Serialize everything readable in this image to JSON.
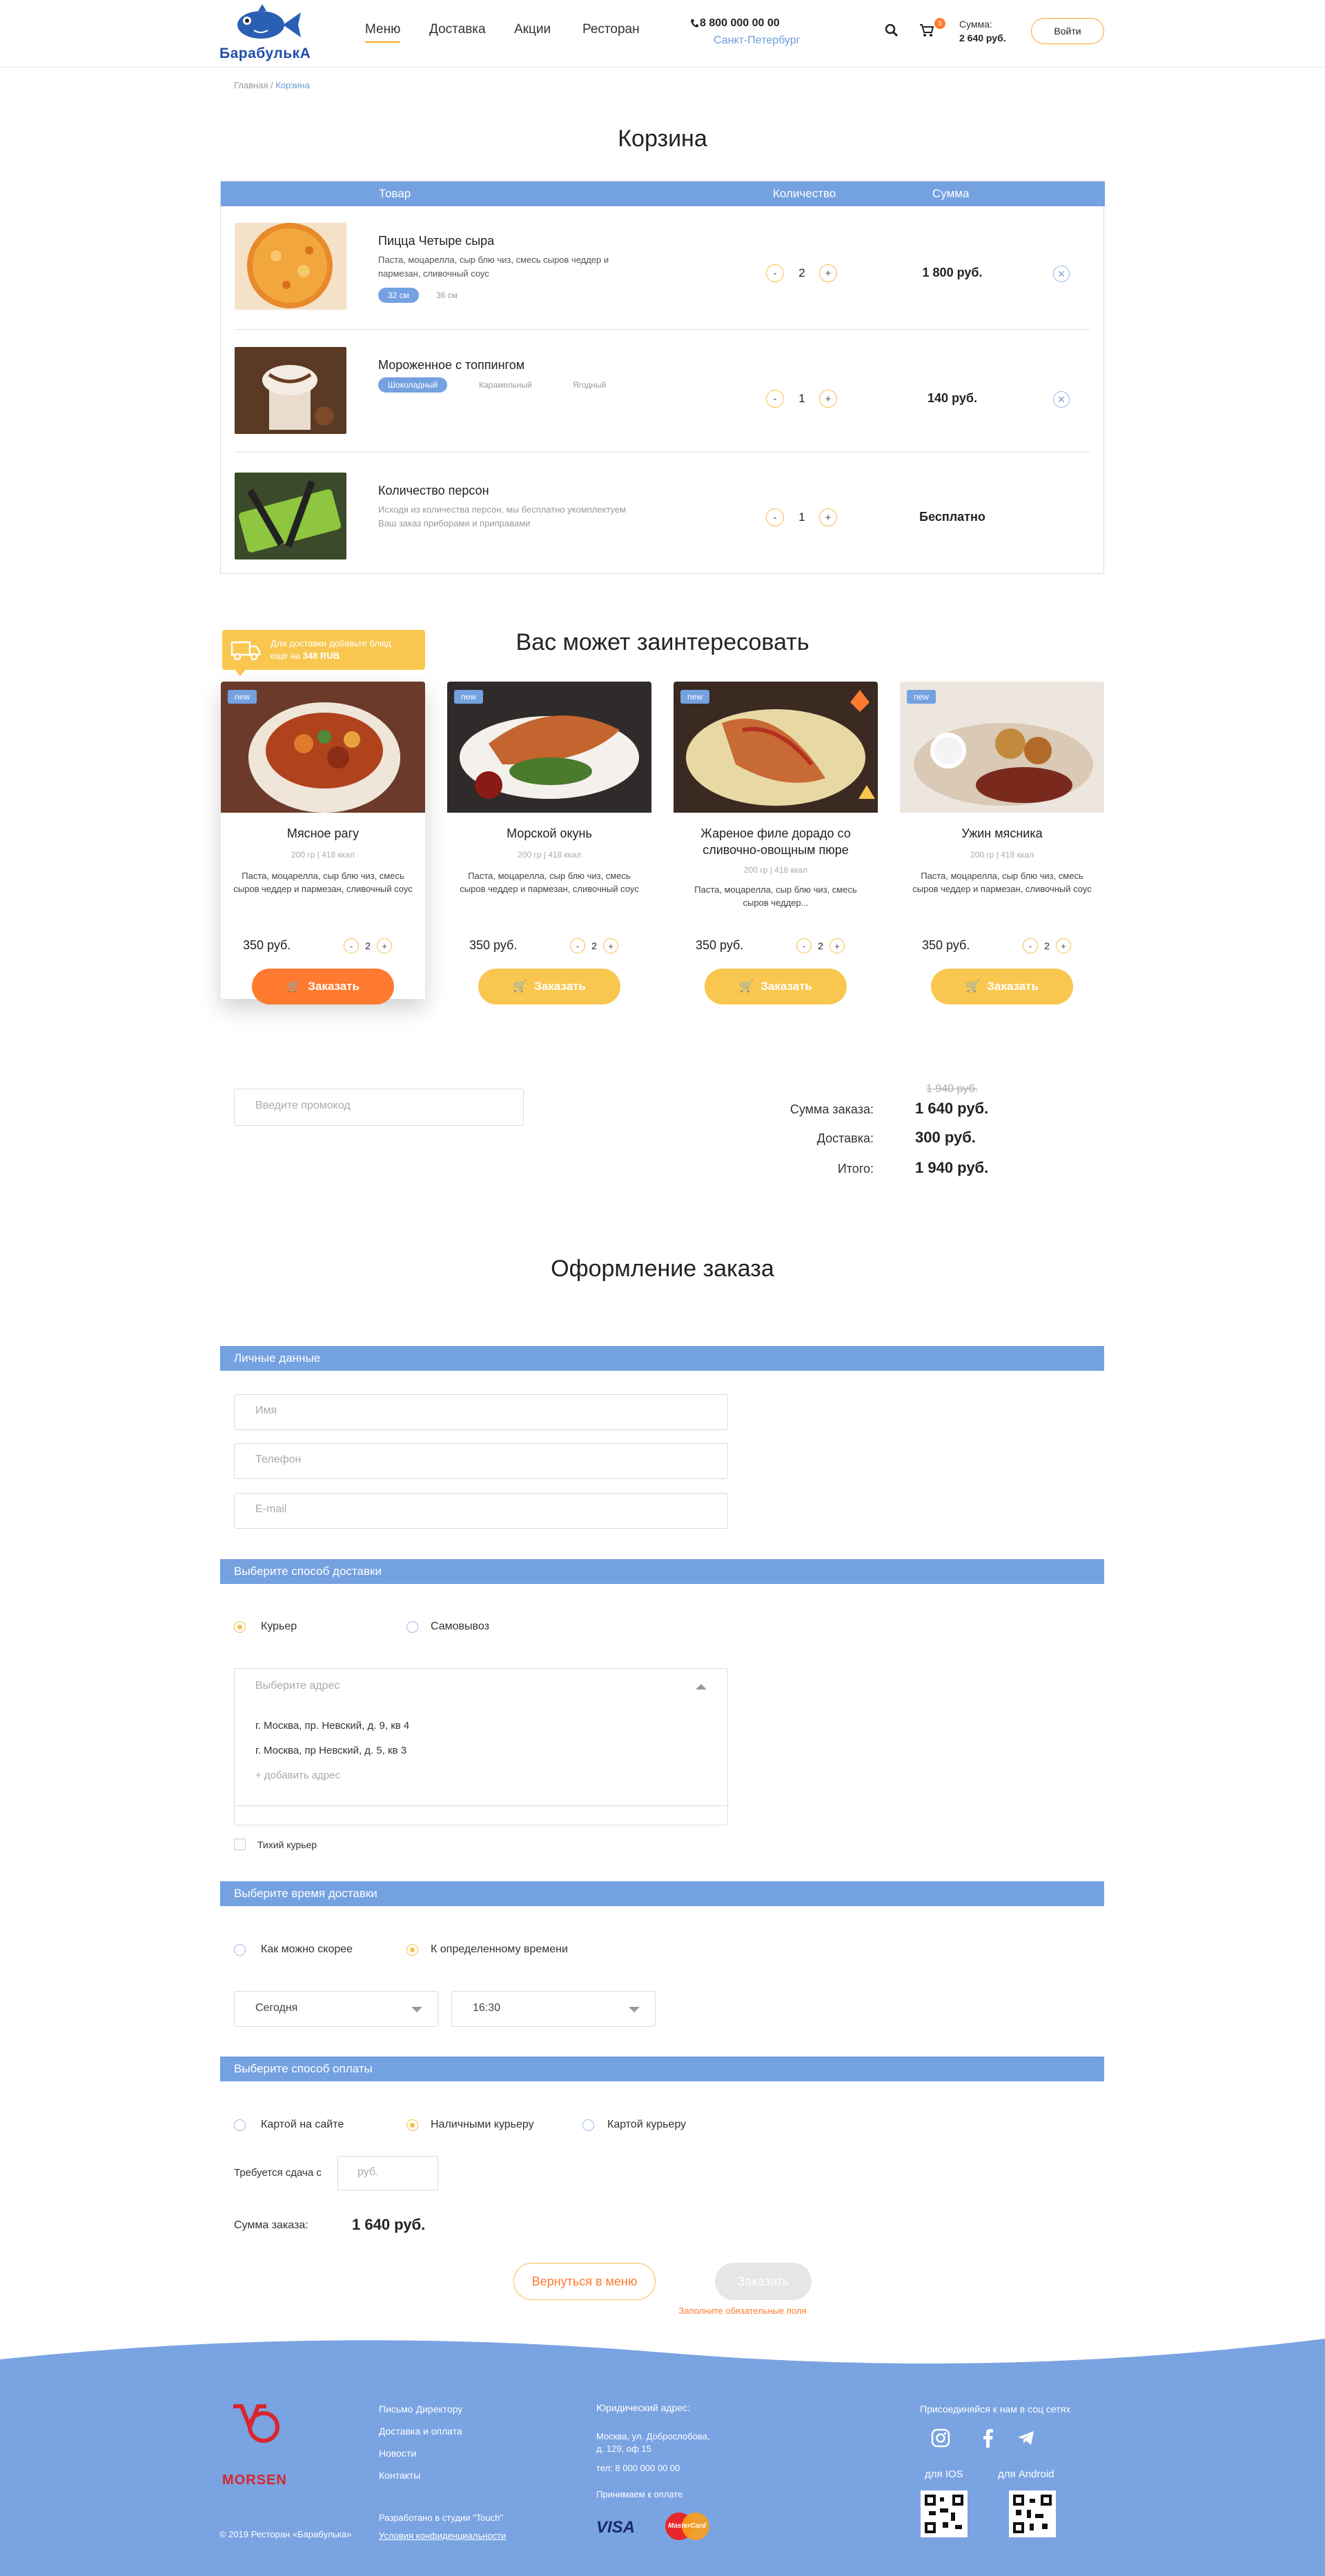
{
  "header": {
    "logo_text": "БарабулькА",
    "nav": [
      "Меню",
      "Доставка",
      "Акции",
      "Ресторан"
    ],
    "phone": "8 800 000 00 00",
    "city": "Санкт-Петербург",
    "cart_count": "5",
    "cart_sum_label": "Сумма:",
    "cart_sum": "2 640 руб.",
    "login": "Войти"
  },
  "breadcrumb": {
    "home": "Главная",
    "sep": " / ",
    "current": "Корзина"
  },
  "cart": {
    "title": "Корзина",
    "columns": {
      "product": "Товар",
      "qty": "Количество",
      "sum": "Сумма"
    },
    "items": [
      {
        "name": "Пицца Четыре сыра",
        "desc": "Паста, моцарелла, сыр блю чиз, смесь сыров чеддер и пармезан, сливочный соус",
        "options": [
          "32 см",
          "36 см"
        ],
        "qty": "2",
        "sum": "1 800 руб.",
        "removable": true
      },
      {
        "name": "Мороженное с топпингом",
        "desc": "",
        "options": [
          "Шоколадный",
          "Карамельный",
          "Ягодный"
        ],
        "qty": "1",
        "sum": "140 руб.",
        "removable": true
      },
      {
        "name": "Количество персон",
        "desc": "Исходя из количества персон, мы бесплатно укомплектуем Ваш заказ приборами и приправами",
        "options": [],
        "qty": "1",
        "sum": "Бесплатно",
        "removable": false
      }
    ],
    "minus": "-",
    "plus": "+"
  },
  "recommend": {
    "title": "Вас может заинтересовать",
    "delivery_banner_line1": "Для доставки добавьте блюд",
    "delivery_banner_line2_prefix": "еще на ",
    "delivery_banner_amount": "348 RUB",
    "badge_new": "new",
    "order_label": "Заказать",
    "items": [
      {
        "title": "Мясное рагу",
        "meta": "200 гр  |  418 ккал",
        "desc": "Паста, моцарелла, сыр блю чиз, смесь сыров чеддер и пармезан, сливочный соус",
        "price": "350 руб.",
        "qty": "2"
      },
      {
        "title": "Морской окунь",
        "meta": "200 гр  |  418 ккал",
        "desc": "Паста, моцарелла, сыр блю чиз, смесь сыров чеддер и пармезан, сливочный соус",
        "price": "350 руб.",
        "qty": "2"
      },
      {
        "title": "Жареное филе дорадо со сливочно-овощным пюре",
        "meta": "200 гр  |  418 ккал",
        "desc": "Паста, моцарелла, сыр блю чиз, смесь сыров чеддер...",
        "price": "350 руб.",
        "qty": "2"
      },
      {
        "title": "Ужин мясника",
        "meta": "200 гр  |  418 ккал",
        "desc": "Паста, моцарелла, сыр блю чиз, смесь сыров чеддер и пармезан, сливочный соус",
        "price": "350 руб.",
        "qty": "2"
      }
    ],
    "colors": {
      "highlight_button": "#ff7a2f",
      "button": "#f9c74f"
    }
  },
  "totals": {
    "promo_placeholder": "Введите промокод",
    "old_sum": "1 940 руб.",
    "order_sum_label": "Сумма заказа:",
    "order_sum": "1 640 руб.",
    "delivery_label": "Доставка:",
    "delivery": "300 руб.",
    "total_label": "Итого:",
    "total": "1 940 руб."
  },
  "checkout": {
    "title": "Оформление заказа",
    "personal": {
      "section": "Личные данные",
      "name_ph": "Имя",
      "phone_ph": "Телефон",
      "email_ph": "E-mail"
    },
    "delivery": {
      "section": "Выберите способ доставки",
      "courier": "Курьер",
      "pickup": "Самовывоз",
      "address_ph": "Выберите адрес",
      "addresses": [
        "г. Москва, пр. Невский, д. 9, кв 4",
        "г. Москва, пр Невский, д. 5, кв 3"
      ],
      "add_address": "+ добавить адрес",
      "quiet": "Тихий курьер"
    },
    "time": {
      "section": "Выберите время доставки",
      "asap": "Как можно скорее",
      "exact": "К определенному времени",
      "day": "Сегодня",
      "hour": "16:30"
    },
    "payment": {
      "section": "Выберите способ оплаты",
      "card_site": "Картой на сайте",
      "cash": "Наличными курьеру",
      "card_courier": "Картой курьеру",
      "change_label": "Требуется сдача с",
      "change_ph": "руб.",
      "sum_label": "Сумма заказа:",
      "sum": "1 640 руб."
    },
    "back": "Вернуться в меню",
    "order": "Заказать",
    "warn": "Заполните обязательные поля"
  },
  "footer": {
    "brand": "MORSEN",
    "copyright": "© 2019 Ресторан «Барабулька»",
    "links": [
      "Письмо Директору",
      "Доставка и оплата",
      "Новости",
      "Контакты"
    ],
    "dev": "Разработано в студии \"Touch\"",
    "privacy": "Условия конфиденциальности",
    "legal_label": "Юридический адрес:",
    "legal_addr1": "Москва, ул. Доброслобова,",
    "legal_addr2": "д. 129, оф 15",
    "legal_phone": "тел: 8 000 000 00 00",
    "accept": "Принимаем к оплате",
    "visa": "VISA",
    "mastercard": "MasterCard",
    "social": "Присоединяйся к нам в соц сетях",
    "ios": "для IOS",
    "android": "для Android"
  },
  "colors": {
    "accent_blue": "#74a1e0",
    "accent_orange": "#ff7a2f",
    "accent_yellow": "#f9c74f",
    "footer_blue": "#7aa3e2"
  }
}
